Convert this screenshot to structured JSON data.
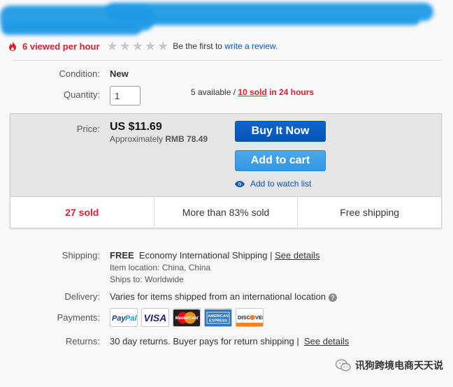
{
  "watch": {
    "views": "6 viewed per hour",
    "review_prefix": "Be the first to",
    "review_link": "write a review."
  },
  "rating": {
    "stars_filled": 0,
    "stars_total": 5
  },
  "item": {
    "condition_label": "Condition:",
    "condition": "New",
    "quantity_label": "Quantity:",
    "quantity_value": "1",
    "available": "5 available /",
    "sold_link": "10 sold",
    "sold_suffix": "in 24 hours"
  },
  "buybox": {
    "price_label": "Price:",
    "price": "US $11.69",
    "approx_prefix": "Approximately",
    "approx_value": "RMB 78.49",
    "buy_now": "Buy It Now",
    "add_to_cart": "Add to cart",
    "watch_list": "Add to watch list",
    "stats": [
      "27 sold",
      "More than 83% sold",
      "Free shipping"
    ]
  },
  "details": {
    "shipping_label": "Shipping:",
    "shipping_free": "FREE",
    "shipping_method": "Economy International Shipping |",
    "see_details": "See details",
    "item_location": "Item location:  China, China",
    "ships_to": "Ships to:  Worldwide",
    "delivery_label": "Delivery:",
    "delivery_text": "Varies for items shipped from an international location",
    "payments_label": "Payments:",
    "payment_methods": [
      "PayPal",
      "VISA",
      "MasterCard",
      "American Express",
      "DISCOVER"
    ],
    "returns_label": "Returns:",
    "returns_text": "30 day returns. Buyer pays for return shipping |",
    "returns_link": "See details"
  },
  "watermark": "讯狗跨境电商天天说",
  "colors": {
    "link": "#0654ba",
    "alert": "#dd1e31",
    "buy": "#0654ba",
    "cart": "#3397e0"
  }
}
